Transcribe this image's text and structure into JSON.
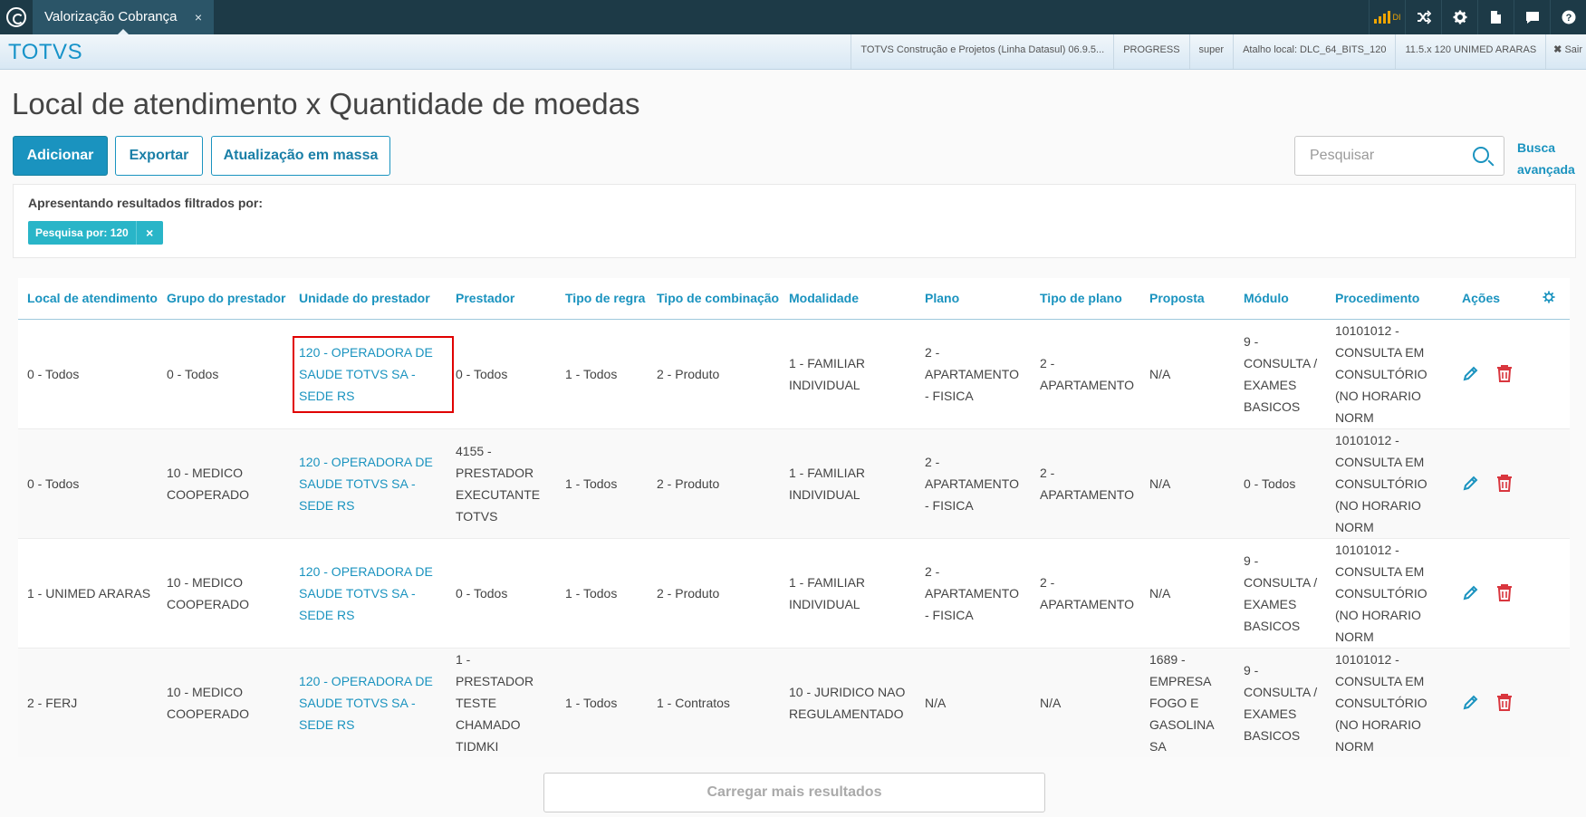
{
  "topbar": {
    "tab_title": "Valorização Cobrança",
    "tab_close": "×",
    "signal_label": "DI",
    "colors": {
      "bar": "#1d3a47",
      "tab": "#2b5568"
    }
  },
  "header": {
    "brand": "TOTVS",
    "info": [
      "TOTVS Construção e Projetos (Linha Datasul) 06.9.5...",
      "PROGRESS",
      "super",
      "Atalho local: DLC_64_BITS_120",
      "11.5.x 120 UNIMED ARARAS"
    ],
    "logout": "Sair"
  },
  "page": {
    "title": "Local de atendimento x Quantidade de moedas",
    "buttons": {
      "add": "Adicionar",
      "export": "Exportar",
      "mass_update": "Atualização em massa"
    },
    "search": {
      "placeholder": "Pesquisar"
    },
    "advanced_search": "Busca avançada",
    "filter": {
      "label": "Apresentando resultados filtrados por:",
      "chip": "Pesquisa por: 120",
      "chip_close": "×"
    },
    "load_more": "Carregar mais resultados"
  },
  "table": {
    "columns": [
      "Local de atendimento",
      "Grupo do prestador",
      "Unidade do prestador",
      "Prestador",
      "Tipo de regra",
      "Tipo de combinação",
      "Modalidade",
      "Plano",
      "Tipo de plano",
      "Proposta",
      "Módulo",
      "Procedimento",
      "Ações"
    ],
    "rows": [
      [
        "0 - Todos",
        "0 - Todos",
        "120 - OPERADORA DE SAUDE TOTVS SA - SEDE RS",
        "0 - Todos",
        "1 - Todos",
        "2 - Produto",
        "1 - FAMILIAR INDIVIDUAL",
        "2 - APARTAMENTO - FISICA",
        "2 - APARTAMENTO",
        "N/A",
        "9 - CONSULTA / EXAMES BASICOS",
        "10101012 - CONSULTA EM CONSULTÓRIO (NO HORARIO NORM"
      ],
      [
        "0 - Todos",
        "10 - MEDICO COOPERADO",
        "120 - OPERADORA DE SAUDE TOTVS SA - SEDE RS",
        "4155 - PRESTADOR EXECUTANTE TOTVS",
        "1 - Todos",
        "2 - Produto",
        "1 - FAMILIAR INDIVIDUAL",
        "2 - APARTAMENTO - FISICA",
        "2 - APARTAMENTO",
        "N/A",
        "0 - Todos",
        "10101012 - CONSULTA EM CONSULTÓRIO (NO HORARIO NORM"
      ],
      [
        "1 - UNIMED ARARAS",
        "10 - MEDICO COOPERADO",
        "120 - OPERADORA DE SAUDE TOTVS SA - SEDE RS",
        "0 - Todos",
        "1 - Todos",
        "2 - Produto",
        "1 - FAMILIAR INDIVIDUAL",
        "2 - APARTAMENTO - FISICA",
        "2 - APARTAMENTO",
        "N/A",
        "9 - CONSULTA / EXAMES BASICOS",
        "10101012 - CONSULTA EM CONSULTÓRIO (NO HORARIO NORM"
      ],
      [
        "2 - FERJ",
        "10 - MEDICO COOPERADO",
        "120 - OPERADORA DE SAUDE TOTVS SA - SEDE RS",
        "1 - PRESTADOR TESTE CHAMADO TIDMKI",
        "1 - Todos",
        "1 - Contratos",
        "10 - JURIDICO NAO REGULAMENTADO",
        "N/A",
        "N/A",
        "1689 - EMPRESA FOGO E GASOLINA SA",
        "9 - CONSULTA / EXAMES BASICOS",
        "10101012 - CONSULTA EM CONSULTÓRIO (NO HORARIO NORM"
      ]
    ],
    "icons": {
      "edit": "pencil-icon",
      "delete": "trash-icon",
      "settings": "gear-icon"
    },
    "colors": {
      "accent": "#1a93bf",
      "delete": "#d9363e",
      "highlight": "#e00000"
    }
  }
}
